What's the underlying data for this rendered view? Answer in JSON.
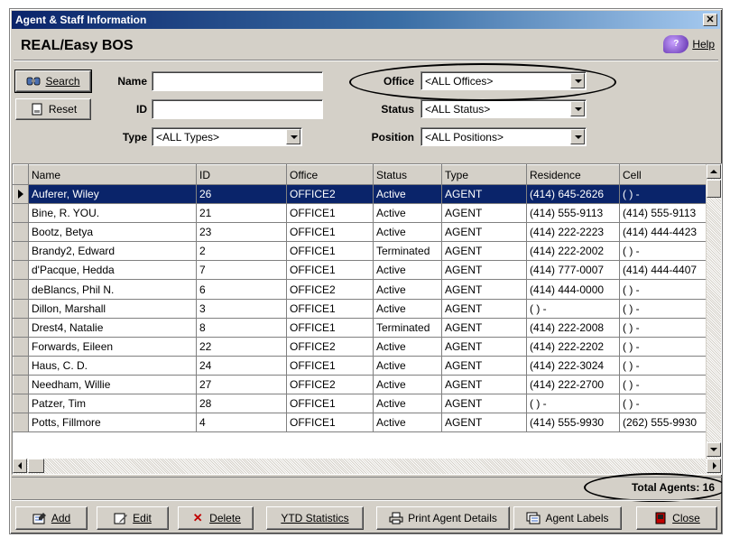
{
  "window": {
    "title": "Agent & Staff Information",
    "close_glyph": "✕"
  },
  "app": {
    "name": "REAL/Easy BOS",
    "help_label": "Help"
  },
  "search_panel": {
    "search_label": "Search",
    "reset_label": "Reset",
    "name_label": "Name",
    "name_value": "",
    "id_label": "ID",
    "id_value": "",
    "type_label": "Type",
    "type_value": "<ALL Types>",
    "office_label": "Office",
    "office_value": "<ALL Offices>",
    "status_label": "Status",
    "status_value": "<ALL Status>",
    "position_label": "Position",
    "position_value": "<ALL Positions>"
  },
  "grid": {
    "columns": [
      "Name",
      "ID",
      "Office",
      "Status",
      "Type",
      "Residence",
      "Cell"
    ],
    "selected_index": 0,
    "rows": [
      [
        "Auferer, Wiley",
        "26",
        "OFFICE2",
        "Active",
        "AGENT",
        "(414) 645-2626",
        "(   )   -"
      ],
      [
        "Bine, R. YOU.",
        "21",
        "OFFICE1",
        "Active",
        "AGENT",
        "(414) 555-9113",
        "(414) 555-9113"
      ],
      [
        "Bootz, Betya",
        "23",
        "OFFICE1",
        "Active",
        "AGENT",
        "(414) 222-2223",
        "(414) 444-4423"
      ],
      [
        "Brandy2, Edward",
        "2",
        "OFFICE1",
        "Terminated",
        "AGENT",
        "(414) 222-2002",
        "(   )   -"
      ],
      [
        "d'Pacque, Hedda",
        "7",
        "OFFICE1",
        "Active",
        "AGENT",
        "(414) 777-0007",
        "(414) 444-4407"
      ],
      [
        "deBlancs, Phil N.",
        "6",
        "OFFICE2",
        "Active",
        "AGENT",
        "(414) 444-0000",
        "(   )   -"
      ],
      [
        "Dillon, Marshall",
        "3",
        "OFFICE1",
        "Active",
        "AGENT",
        "(   )   -",
        "(   )   -"
      ],
      [
        "Drest4, Natalie",
        "8",
        "OFFICE1",
        "Terminated",
        "AGENT",
        "(414) 222-2008",
        "(   )   -"
      ],
      [
        "Forwards, Eileen",
        "22",
        "OFFICE2",
        "Active",
        "AGENT",
        "(414) 222-2202",
        "(   )   -"
      ],
      [
        "Haus, C. D.",
        "24",
        "OFFICE1",
        "Active",
        "AGENT",
        "(414) 222-3024",
        "(   )   -"
      ],
      [
        "Needham, Willie",
        "27",
        "OFFICE2",
        "Active",
        "AGENT",
        "(414) 222-2700",
        "(   )   -"
      ],
      [
        "Patzer, Tim",
        "28",
        "OFFICE1",
        "Active",
        "AGENT",
        "(   )   -",
        "(   )   -"
      ],
      [
        "Potts, Fillmore",
        "4",
        "OFFICE1",
        "Active",
        "AGENT",
        "(414) 555-9930",
        "(262) 555-9930"
      ]
    ]
  },
  "status": {
    "total_agents_text": "Total Agents: 16"
  },
  "toolbar": {
    "add_label": "Add",
    "edit_label": "Edit",
    "delete_label": "Delete",
    "ytd_label": "YTD Statistics",
    "print_label": "Print Agent Details",
    "labels_label": "Agent Labels",
    "close_label": "Close"
  },
  "colors": {
    "selection": "#0a246a",
    "face": "#d4d0c8",
    "title_gradient_start": "#0a246a",
    "title_gradient_end": "#a6caf0"
  },
  "icons": {
    "search": "binoculars-icon",
    "reset": "eraser-icon",
    "help": "help-book-icon",
    "add": "add-record-icon",
    "edit": "edit-icon",
    "delete": "delete-x-icon",
    "print": "printer-icon",
    "labels": "labels-icon",
    "close": "door-exit-icon"
  }
}
